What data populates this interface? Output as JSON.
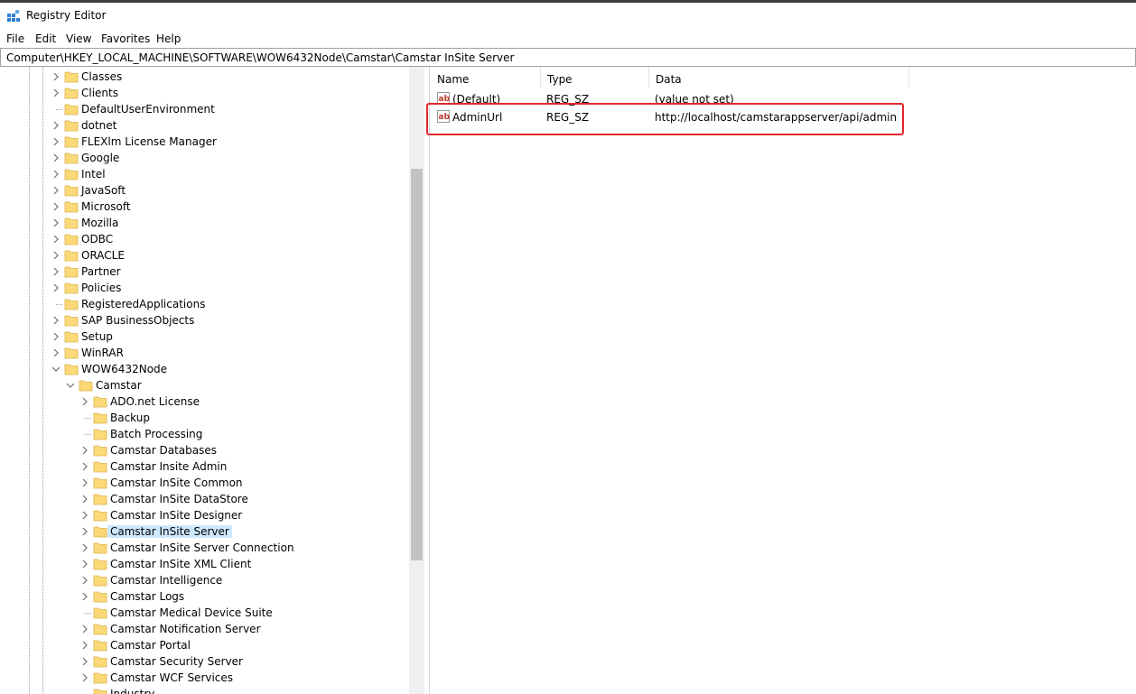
{
  "window": {
    "title": "Registry Editor"
  },
  "menu": [
    "File",
    "Edit",
    "View",
    "Favorites",
    "Help"
  ],
  "address": "Computer\\HKEY_LOCAL_MACHINE\\SOFTWARE\\WOW6432Node\\Camstar\\Camstar InSite Server",
  "tree": [
    {
      "label": "Classes",
      "depth": 0,
      "expander": "collapsed"
    },
    {
      "label": "Clients",
      "depth": 0,
      "expander": "collapsed"
    },
    {
      "label": "DefaultUserEnvironment",
      "depth": 0,
      "expander": "none"
    },
    {
      "label": "dotnet",
      "depth": 0,
      "expander": "collapsed"
    },
    {
      "label": "FLEXlm License Manager",
      "depth": 0,
      "expander": "collapsed"
    },
    {
      "label": "Google",
      "depth": 0,
      "expander": "collapsed"
    },
    {
      "label": "Intel",
      "depth": 0,
      "expander": "collapsed"
    },
    {
      "label": "JavaSoft",
      "depth": 0,
      "expander": "collapsed"
    },
    {
      "label": "Microsoft",
      "depth": 0,
      "expander": "collapsed"
    },
    {
      "label": "Mozilla",
      "depth": 0,
      "expander": "collapsed"
    },
    {
      "label": "ODBC",
      "depth": 0,
      "expander": "collapsed"
    },
    {
      "label": "ORACLE",
      "depth": 0,
      "expander": "collapsed"
    },
    {
      "label": "Partner",
      "depth": 0,
      "expander": "collapsed"
    },
    {
      "label": "Policies",
      "depth": 0,
      "expander": "collapsed"
    },
    {
      "label": "RegisteredApplications",
      "depth": 0,
      "expander": "none"
    },
    {
      "label": "SAP BusinessObjects",
      "depth": 0,
      "expander": "collapsed"
    },
    {
      "label": "Setup",
      "depth": 0,
      "expander": "collapsed"
    },
    {
      "label": "WinRAR",
      "depth": 0,
      "expander": "collapsed"
    },
    {
      "label": "WOW6432Node",
      "depth": 0,
      "expander": "expanded"
    },
    {
      "label": "Camstar",
      "depth": 1,
      "expander": "expanded"
    },
    {
      "label": "ADO.net License",
      "depth": 2,
      "expander": "collapsed"
    },
    {
      "label": "Backup",
      "depth": 2,
      "expander": "none"
    },
    {
      "label": "Batch Processing",
      "depth": 2,
      "expander": "none"
    },
    {
      "label": "Camstar Databases",
      "depth": 2,
      "expander": "collapsed"
    },
    {
      "label": "Camstar Insite Admin",
      "depth": 2,
      "expander": "collapsed"
    },
    {
      "label": "Camstar InSite Common",
      "depth": 2,
      "expander": "collapsed"
    },
    {
      "label": "Camstar InSite DataStore",
      "depth": 2,
      "expander": "collapsed"
    },
    {
      "label": "Camstar InSite Designer",
      "depth": 2,
      "expander": "collapsed"
    },
    {
      "label": "Camstar InSite Server",
      "depth": 2,
      "expander": "collapsed",
      "selected": true
    },
    {
      "label": "Camstar InSite Server Connection",
      "depth": 2,
      "expander": "collapsed"
    },
    {
      "label": "Camstar InSite XML Client",
      "depth": 2,
      "expander": "collapsed"
    },
    {
      "label": "Camstar Intelligence",
      "depth": 2,
      "expander": "collapsed"
    },
    {
      "label": "Camstar Logs",
      "depth": 2,
      "expander": "collapsed"
    },
    {
      "label": "Camstar Medical Device Suite",
      "depth": 2,
      "expander": "none"
    },
    {
      "label": "Camstar Notification Server",
      "depth": 2,
      "expander": "collapsed"
    },
    {
      "label": "Camstar Portal",
      "depth": 2,
      "expander": "collapsed"
    },
    {
      "label": "Camstar Security Server",
      "depth": 2,
      "expander": "collapsed"
    },
    {
      "label": "Camstar WCF Services",
      "depth": 2,
      "expander": "collapsed"
    },
    {
      "label": "Industry",
      "depth": 2,
      "expander": "none"
    }
  ],
  "columns": {
    "name": "Name",
    "type": "Type",
    "data": "Data"
  },
  "values": [
    {
      "name": "(Default)",
      "type": "REG_SZ",
      "data": "(value not set)"
    },
    {
      "name": "AdminUrl",
      "type": "REG_SZ",
      "data": "http://localhost/camstarappserver/api/admin"
    }
  ],
  "colors": {
    "selection": "#cce8ff",
    "highlight": "#e3262d",
    "folder": "#fcd978"
  },
  "icons": {
    "app": "registry-editor-icon",
    "folder": "folder-icon",
    "string_value": "string-value-ab-icon",
    "expand": "chevron-right-icon",
    "collapse": "chevron-down-icon"
  }
}
